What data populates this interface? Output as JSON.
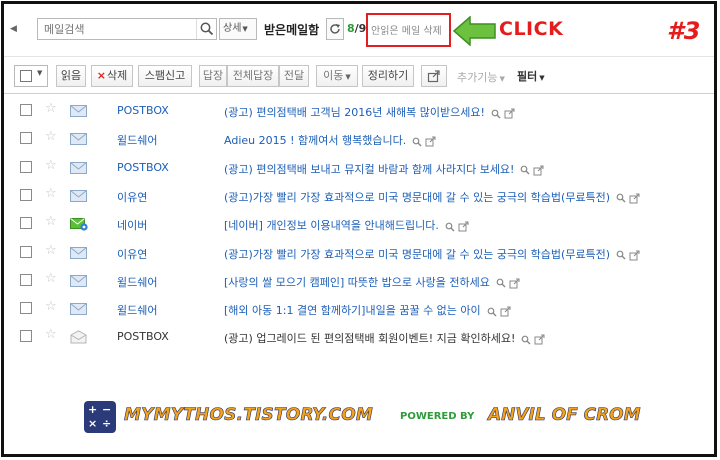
{
  "search": {
    "placeholder": "메일검색",
    "detail_label": "상세"
  },
  "folder": {
    "title": "받은메일함",
    "unread_count": "8",
    "total_count": "/9"
  },
  "header": {
    "delete_unread_label": "안읽은 메일 삭제"
  },
  "annotation": {
    "click_text": "CLICK",
    "step_number": "#3",
    "highlight_color": "#e02020",
    "arrow_color": "#5cb531"
  },
  "toolbar": {
    "read_label": "읽음",
    "delete_label": "삭제",
    "spam_label": "스팸신고",
    "reply_label": "답장",
    "reply_all_label": "전체답장",
    "forward_label": "전달",
    "move_label": "이동",
    "organize_label": "정리하기",
    "more_label": "추가기능",
    "filter_label": "필터"
  },
  "mails": [
    {
      "sender": "POSTBOX",
      "subject": "(광고) 편의점택배 고객님 2016년 새해복 많이받으세요!",
      "read": false,
      "icon": "envelope-icon"
    },
    {
      "sender": "윌드쉐어",
      "subject": "Adieu 2015 ! 함께여서 행복했습니다.",
      "read": false,
      "icon": "envelope-icon"
    },
    {
      "sender": "POSTBOX",
      "subject": "(광고) 편의점택배 보내고 뮤지컬 바람과 함께 사라지다 보세요!",
      "read": false,
      "icon": "envelope-icon"
    },
    {
      "sender": "이유연",
      "subject": "(광고)가장 빨리 가장 효과적으로 미국 명문대에 갈 수 있는 궁극의 학습법(무료특전)",
      "read": false,
      "icon": "envelope-icon"
    },
    {
      "sender": "네이버",
      "subject": "[네이버] 개인정보 이용내역을 안내해드립니다.",
      "read": false,
      "icon": "naver-envelope-icon"
    },
    {
      "sender": "이유연",
      "subject": "(광고)가장 빨리 가장 효과적으로 미국 명문대에 갈 수 있는 궁극의 학습법(무료특전)",
      "read": false,
      "icon": "envelope-icon"
    },
    {
      "sender": "윌드쉐어",
      "subject": "[사랑의 쌀 모으기 캠페인] 따뜻한 밥으로 사랑을 전하세요",
      "read": false,
      "icon": "envelope-icon"
    },
    {
      "sender": "윌드쉐어",
      "subject": "[해외 아동 1:1 결연 함께하기]내일을 꿈꿀 수 없는 아이",
      "read": false,
      "icon": "envelope-icon"
    },
    {
      "sender": "POSTBOX",
      "subject": "(광고) 업그레이드 된 편의점택배 회원이벤트! 지금 확인하세요!",
      "read": true,
      "icon": "open-envelope-icon"
    }
  ],
  "watermark": {
    "site": "MYMYTHOS.TISTORY.COM",
    "powered_by": "POWERED BY",
    "brand": "ANVIL OF CROM"
  },
  "colors": {
    "link_blue": "#1c5fb8",
    "unread_green": "#2e9c3a",
    "watermark_orange": "#f2a21b",
    "watermark_navy": "#24306b"
  }
}
